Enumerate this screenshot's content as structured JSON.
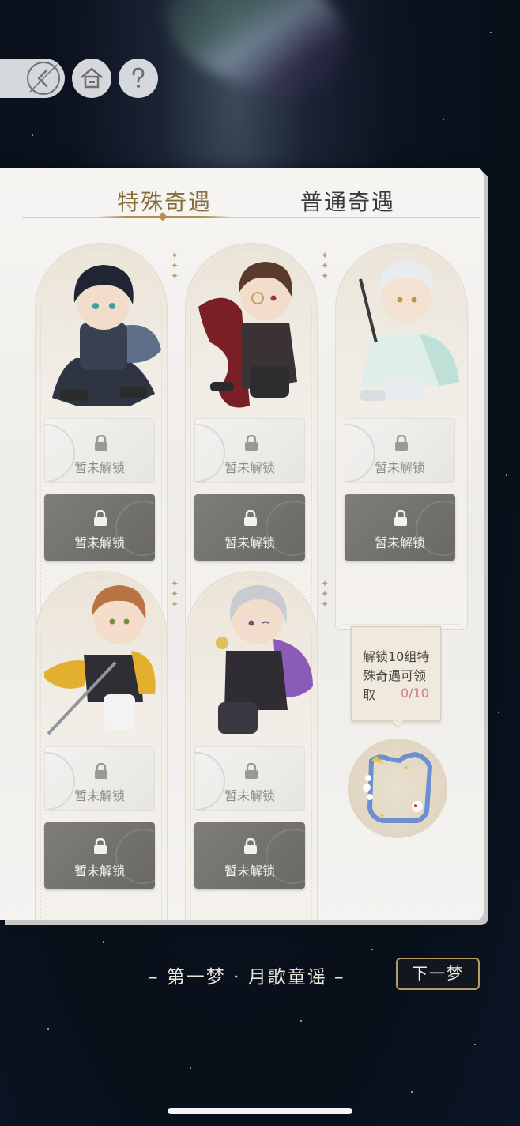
{
  "tabs": [
    {
      "label": "特殊奇遇",
      "active": true
    },
    {
      "label": "普通奇遇",
      "active": false
    }
  ],
  "icons": {
    "back": "back-arrow-icon",
    "home": "home-icon",
    "help": "question-mark-icon",
    "lock": "lock-icon"
  },
  "cards": [
    {
      "character": "dark-haired-knight",
      "slot_light": "暂未解锁",
      "slot_dark": "暂未解锁"
    },
    {
      "character": "red-caped-noble",
      "slot_light": "暂未解锁",
      "slot_dark": "暂未解锁"
    },
    {
      "character": "silver-haired-mage",
      "slot_light": "暂未解锁",
      "slot_dark": "暂未解锁"
    },
    {
      "character": "golden-swordsman",
      "slot_light": "暂未解锁",
      "slot_dark": "暂未解锁"
    },
    {
      "character": "grey-haired-lord",
      "slot_light": "暂未解锁",
      "slot_dark": "暂未解锁"
    }
  ],
  "reward": {
    "tip": "解锁10组特殊奇遇可领取",
    "progress_text": "0/10",
    "progress_value": 0,
    "progress_max": 10
  },
  "footer": {
    "chapter": "– 第一梦 · 月歌童谣 –",
    "next_label": "下一梦"
  },
  "colors": {
    "accent_gold": "#b08e54",
    "progress_red": "#d9797f",
    "panel_bg": "#f4f3f1"
  }
}
